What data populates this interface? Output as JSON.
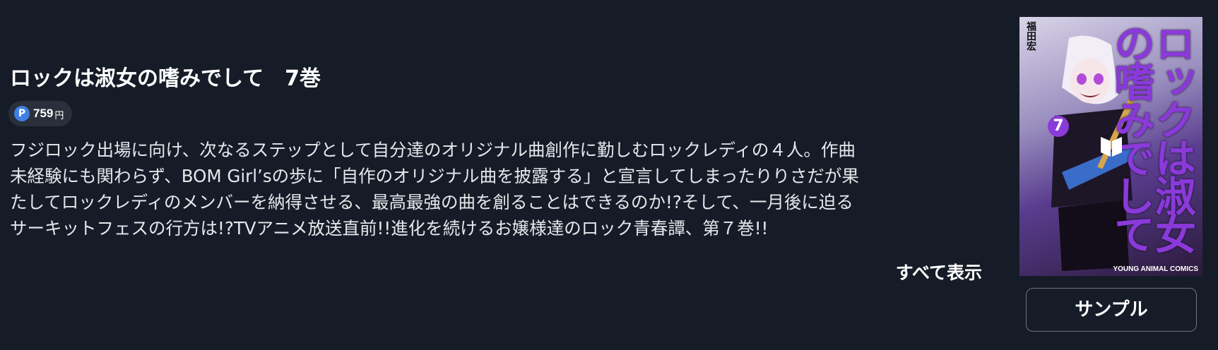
{
  "book": {
    "title": "ロックは淑女の嗜みでして　7巻",
    "price": {
      "icon_name": "point-icon",
      "icon_letter": "P",
      "value": "759",
      "unit": "円"
    },
    "description_lines": [
      "フジロック出場に向け、次なるステップとして自分達のオリジナル曲創作に勤しむロックレディの４人。作曲",
      "未経験にも関わらず、BOM Girl’sの歩に「自作のオリジナル曲を披露する」と宣言してしまったりりさだが果",
      "たしてロックレディのメンバーを納得させる、最高最強の曲を創ることはできるのか!?そして、一月後に迫る",
      "サーキットフェスの行方は!?TVアニメ放送直前!!進化を続けるお嬢様達のロック青春譚、第７巻!!"
    ],
    "show_all_label": "すべて表示",
    "cover": {
      "art_title": "ロックは淑女の嗜みでして",
      "author": "福田宏",
      "volume": "7",
      "label": "YOUNG ANIMAL COMICS",
      "overlay_icon": "book-reader-icon"
    },
    "sample_label": "サンプル"
  },
  "colors": {
    "background": "#161c27",
    "pill_background": "#2a303b",
    "point_blue": "#3f7fe3",
    "button_border": "#6b717d",
    "cover_accent": "#8a3ad9"
  }
}
